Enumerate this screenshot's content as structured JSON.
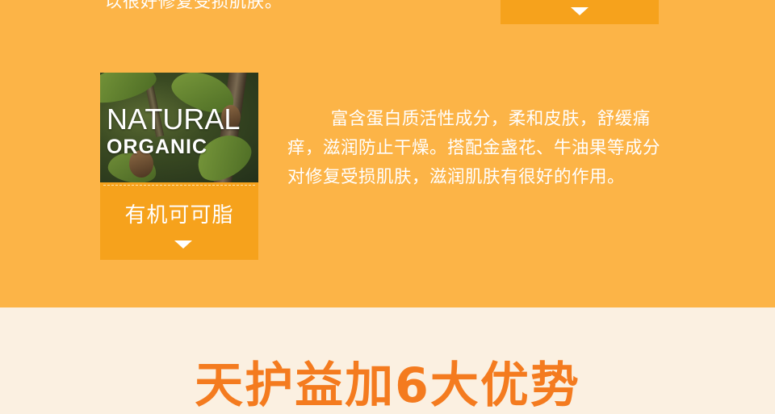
{
  "top": {
    "text": "以很好修复受损肌肤。"
  },
  "ingredient": {
    "photo": {
      "line1": "NATURAL",
      "line2": "ORGANIC"
    },
    "label": "有机可可脂",
    "description": "富含蛋白质活性成分，柔和皮肤，舒缓痛痒，滋润防止干燥。搭配金盏花、牛油果等成分对修复受损肌肤，滋润肌肤有很好的作用。"
  },
  "section": {
    "title": "天护益加6大优势"
  },
  "colors": {
    "band": "#fcb447",
    "card": "#f6a21c",
    "cream": "#fbf0e1",
    "title": "#f47b1f"
  }
}
